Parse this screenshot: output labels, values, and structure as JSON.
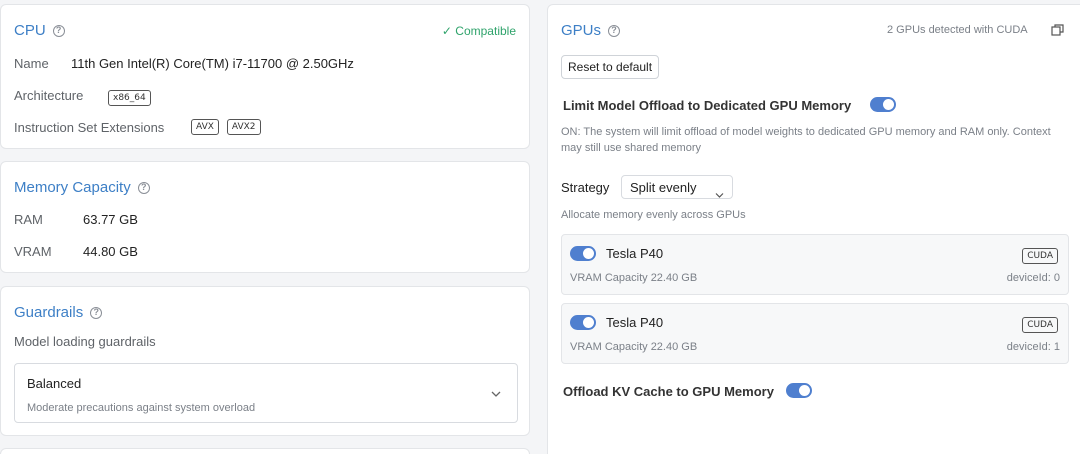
{
  "cpu": {
    "title": "CPU",
    "compatible": "Compatible",
    "name_label": "Name",
    "name_value": "11th Gen Intel(R) Core(TM) i7-11700 @ 2.50GHz",
    "arch_label": "Architecture",
    "arch_value": "x86_64",
    "ise_label": "Instruction Set Extensions",
    "ise_tags": [
      "AVX",
      "AVX2"
    ]
  },
  "memory": {
    "title": "Memory Capacity",
    "ram_label": "RAM",
    "ram_value": "63.77 GB",
    "vram_label": "VRAM",
    "vram_value": "44.80 GB"
  },
  "guardrails": {
    "title": "Guardrails",
    "subtitle": "Model loading guardrails",
    "selected": "Balanced",
    "selected_desc": "Moderate precautions against system overload"
  },
  "gpus": {
    "title": "GPUs",
    "detected": "2 GPUs detected with CUDA",
    "reset_label": "Reset to default",
    "limit_label": "Limit Model Offload to Dedicated GPU Memory",
    "limit_enabled": true,
    "limit_desc": "ON: The system will limit offload of model weights to dedicated GPU memory and RAM only. Context may still use shared memory",
    "strategy_label": "Strategy",
    "strategy_value": "Split evenly",
    "strategy_desc": "Allocate memory evenly across GPUs",
    "devices": [
      {
        "name": "Tesla P40",
        "badge": "CUDA",
        "vram": "VRAM Capacity 22.40 GB",
        "device_id": "deviceId: 0",
        "enabled": true
      },
      {
        "name": "Tesla P40",
        "badge": "CUDA",
        "vram": "VRAM Capacity 22.40 GB",
        "device_id": "deviceId: 1",
        "enabled": true
      }
    ],
    "kv_label": "Offload KV Cache to GPU Memory",
    "kv_enabled": true
  },
  "colors": {
    "accent": "#3d7fc6",
    "toggle_on": "#4f7fcf",
    "compatible": "#2fa36b"
  }
}
